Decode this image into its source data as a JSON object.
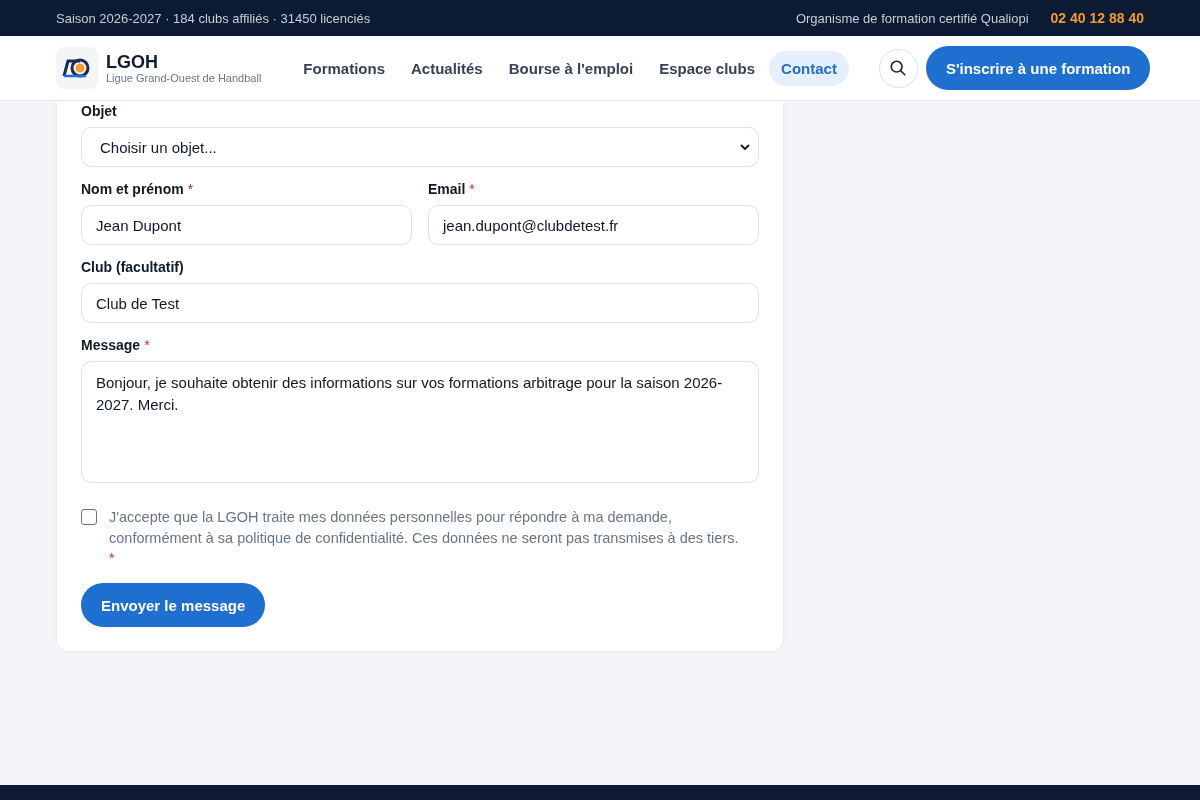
{
  "top_bar": {
    "info": "Saison 2026-2027 · 184 clubs affiliés · 31450 licenciés",
    "certification": "Organisme de formation certifié Qualiopi",
    "phone": "02 40 12 88 40"
  },
  "header": {
    "brand": "LGOH",
    "tagline": "Ligue Grand-Ouest de Handball",
    "nav": [
      {
        "label": "Formations",
        "selected": false
      },
      {
        "label": "Actualités",
        "selected": false
      },
      {
        "label": "Bourse à l'emploi",
        "selected": false
      },
      {
        "label": "Espace clubs",
        "selected": false
      },
      {
        "label": "Contact",
        "selected": true
      }
    ],
    "cta": "S'inscrire à une formation"
  },
  "form": {
    "fields": [
      {
        "kind": "select",
        "label": "Objet",
        "value": "Choisir un objet...",
        "half": false
      },
      {
        "kind": "text",
        "label": "Nom et prénom",
        "required_mark": "*",
        "value": "Jean Dupont",
        "half": true
      },
      {
        "kind": "text",
        "label": "Email",
        "required_mark": "*",
        "value": "jean.dupont@clubdetest.fr",
        "half": true
      },
      {
        "kind": "text",
        "label": "Club (facultatif)",
        "value": "Club de Test",
        "half": false
      },
      {
        "kind": "textarea",
        "label": "Message",
        "required_mark": "*",
        "value": "Bonjour, je souhaite obtenir des informations sur vos formations arbitrage pour la saison 2026-2027. Merci.",
        "half": false
      }
    ],
    "consent": {
      "text": "J'accepte que la LGOH traite mes données personnelles pour répondre à ma demande, conformément à sa politique de confidentialité. Ces données ne seront pas transmises à des tiers.",
      "required_mark": "*",
      "checked": false
    },
    "submit": "Envoyer le message"
  }
}
